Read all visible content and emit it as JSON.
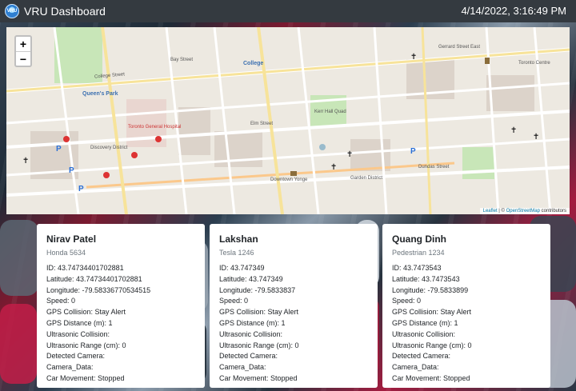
{
  "navbar": {
    "brand": "VRU Dashboard",
    "logo_icon": "vru-logo-icon",
    "datetime": "4/14/2022, 3:16:49 PM"
  },
  "map": {
    "zoom_in": "+",
    "zoom_out": "−",
    "attribution": {
      "leaflet": "Leaflet",
      "separator": " | © ",
      "osm": "OpenStreetMap",
      "contributors": " contributors"
    },
    "labels": {
      "queens_park": "Queen's Park",
      "college": "College",
      "college_street": "College Street",
      "elm_street": "Elm Street",
      "gerrard": "Gerrard Street East",
      "discovery": "Discovery District",
      "garden": "Garden District",
      "downtown": "Downtown Yonge",
      "kerr_hall": "Kerr Hall Quad",
      "toronto_general": "Toronto General Hospital",
      "bay_street": "Bay Street",
      "dundas": "Dundas Street",
      "toronto_centre": "Toronto Centre"
    }
  },
  "cards": [
    {
      "name": "Nirav Patel",
      "vehicle": "Honda 5634",
      "id": "ID: 43.74734401702881",
      "latitude": "Latitude: 43.74734401702881",
      "longitude": "Longitude: -79.58336770534515",
      "speed": "Speed: 0",
      "gps_collision": "GPS Collision: Stay Alert",
      "gps_distance": "GPS Distance (m): 1",
      "ultrasonic_collision": "Ultrasonic Collision:",
      "ultrasonic_range": "Ultrasonic Range (cm): 0",
      "detected_camera": "Detected Camera:",
      "camera_data": "Camera_Data:",
      "car_movement": "Car Movement: Stopped"
    },
    {
      "name": "Lakshan",
      "vehicle": "Tesla 1246",
      "id": "ID: 43.747349",
      "latitude": "Latitude: 43.747349",
      "longitude": "Longitude: -79.5833837",
      "speed": "Speed: 0",
      "gps_collision": "GPS Collision: Stay Alert",
      "gps_distance": "GPS Distance (m): 1",
      "ultrasonic_collision": "Ultrasonic Collision:",
      "ultrasonic_range": "Ultrasonic Range (cm): 0",
      "detected_camera": "Detected Camera:",
      "camera_data": "Camera_Data:",
      "car_movement": "Car Movement: Stopped"
    },
    {
      "name": "Quang Dinh",
      "vehicle": "Pedestrian 1234",
      "id": "ID: 43.7473543",
      "latitude": "Latitude: 43.7473543",
      "longitude": "Longitude: -79.5833899",
      "speed": "Speed: 0",
      "gps_collision": "GPS Collision: Stay Alert",
      "gps_distance": "GPS Distance (m): 1",
      "ultrasonic_collision": "Ultrasonic Collision:",
      "ultrasonic_range": "Ultrasonic Range (cm): 0",
      "detected_camera": "Detected Camera:",
      "camera_data": "Camera_Data:",
      "car_movement": "Car Movement: Stopped"
    }
  ]
}
